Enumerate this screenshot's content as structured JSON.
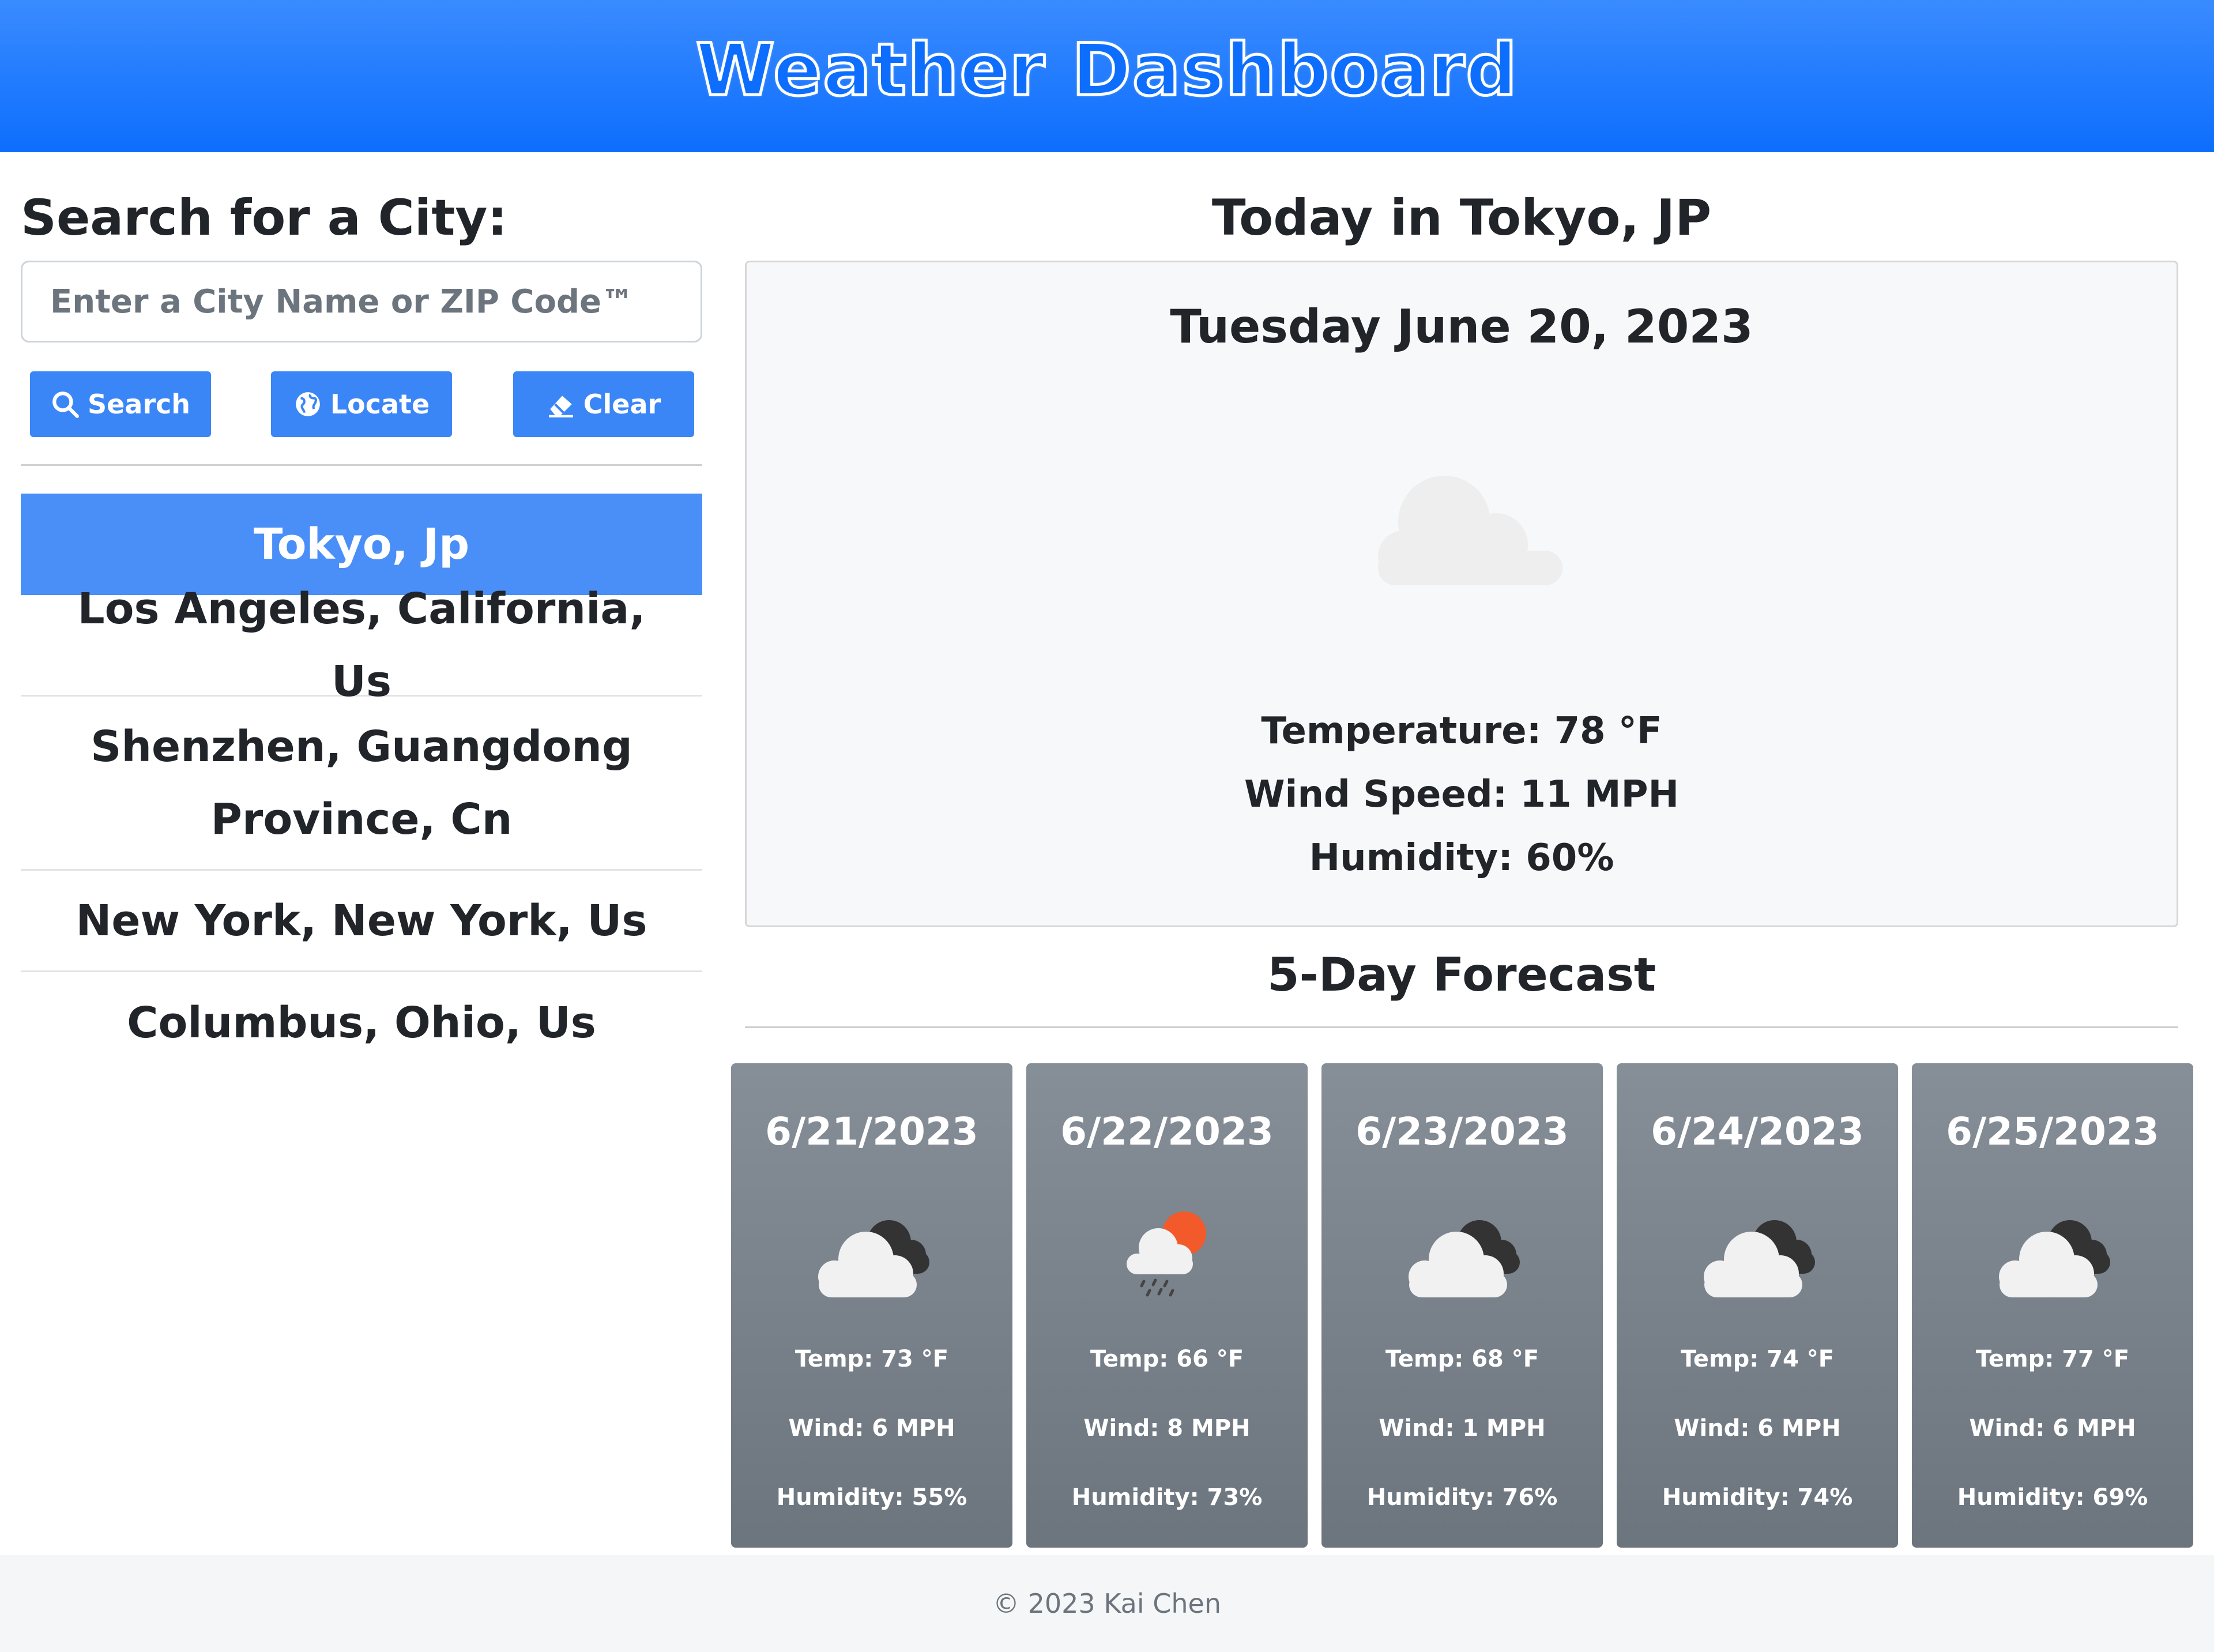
{
  "header": {
    "title": "Weather Dashboard"
  },
  "search": {
    "title": "Search for a City:",
    "placeholder": "Enter a City Name or ZIP Code™",
    "buttons": {
      "search": "Search",
      "locate": "Locate",
      "clear": "Clear"
    }
  },
  "history": [
    "Tokyo, Jp",
    "Los Angeles, California, Us",
    "Shenzhen, Guangdong Province, Cn",
    "New York, New York, Us",
    "Columbus, Ohio, Us"
  ],
  "today": {
    "title": "Today in Tokyo, JP",
    "date": "Tuesday June 20, 2023",
    "icon": "cloud-icon",
    "temperature": "Temperature: 78 °F",
    "wind": "Wind Speed: 11 MPH",
    "humidity": "Humidity: 60%"
  },
  "forecast": {
    "title": "5-Day Forecast",
    "days": [
      {
        "date": "6/21/2023",
        "icon": "broken-clouds-icon",
        "temp": "Temp: 73 °F",
        "wind": "Wind: 6 MPH",
        "humidity": "Humidity: 55%"
      },
      {
        "date": "6/22/2023",
        "icon": "rain-sun-icon",
        "temp": "Temp: 66 °F",
        "wind": "Wind: 8 MPH",
        "humidity": "Humidity: 73%"
      },
      {
        "date": "6/23/2023",
        "icon": "broken-clouds-icon",
        "temp": "Temp: 68 °F",
        "wind": "Wind: 1 MPH",
        "humidity": "Humidity: 76%"
      },
      {
        "date": "6/24/2023",
        "icon": "broken-clouds-icon",
        "temp": "Temp: 74 °F",
        "wind": "Wind: 6 MPH",
        "humidity": "Humidity: 74%"
      },
      {
        "date": "6/25/2023",
        "icon": "broken-clouds-icon",
        "temp": "Temp: 77 °F",
        "wind": "Wind: 6 MPH",
        "humidity": "Humidity: 69%"
      }
    ]
  },
  "footer": {
    "text": "© 2023 Kai Chen"
  },
  "colors": {
    "primary": "#0d6efd",
    "active_city": "#4a8ff7",
    "card": "#6c757d"
  }
}
